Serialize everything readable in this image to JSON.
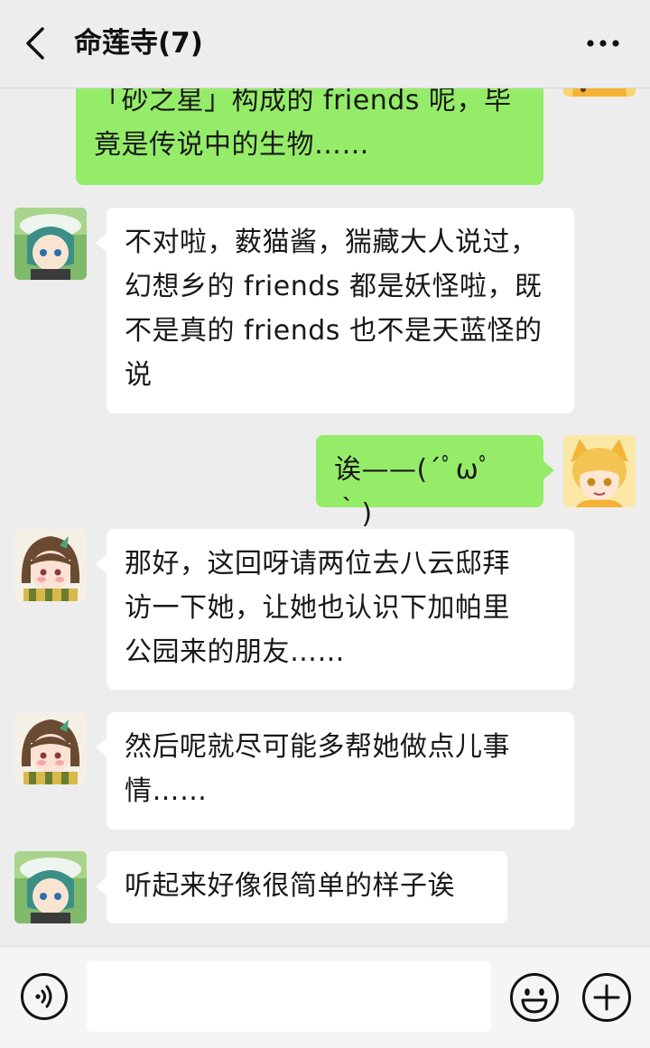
{
  "header": {
    "title": "命莲寺(7)",
    "back_icon": "chevron-left-icon",
    "more_icon": "ellipsis-icon"
  },
  "messages": [
    {
      "side": "out",
      "sender": "serval",
      "text": "「砂之星」构成的 friends 呢，毕竟是传说中的生物……",
      "line1": "「砂之星」构成的 friends 呢，毕",
      "line2": "竟是传说中的生物……"
    },
    {
      "side": "in",
      "sender": "kaban",
      "text": "不对啦，薮猫酱，猯藏大人说过，幻想乡的 friends 都是妖怪啦，既不是真的 friends 也不是天蓝怪的说",
      "line1": "不对啦，薮猫酱，猯藏大人说过，",
      "line2": "幻想乡的 friends 都是妖怪啦，既",
      "line3": "不是真的 friends 也不是天蓝怪的",
      "line4": "说"
    },
    {
      "side": "out",
      "sender": "serval",
      "text": "诶——(´ﾟωﾟ｀)"
    },
    {
      "side": "in",
      "sender": "kyouko",
      "text": "那好，这回呀请两位去八云邸拜访一下她，让她也认识下加帕里公园来的朋友……",
      "line1": "那好，这回呀请两位去八云邸拜",
      "line2": "访一下她，让她也认识下加帕里",
      "line3": "公园来的朋友……"
    },
    {
      "side": "in",
      "sender": "kyouko",
      "text": "然后呢就尽可能多帮她做点儿事情……",
      "line1": "然后呢就尽可能多帮她做点儿事",
      "line2": "情……"
    },
    {
      "side": "in",
      "sender": "kaban",
      "text": "听起来好像很简单的样子诶"
    }
  ],
  "input": {
    "placeholder": "",
    "voice_icon": "voice-icon",
    "emoji_icon": "emoji-icon",
    "plus_icon": "plus-icon"
  },
  "colors": {
    "background": "#ededed",
    "bubble_out": "#95ec69",
    "bubble_in": "#ffffff"
  }
}
